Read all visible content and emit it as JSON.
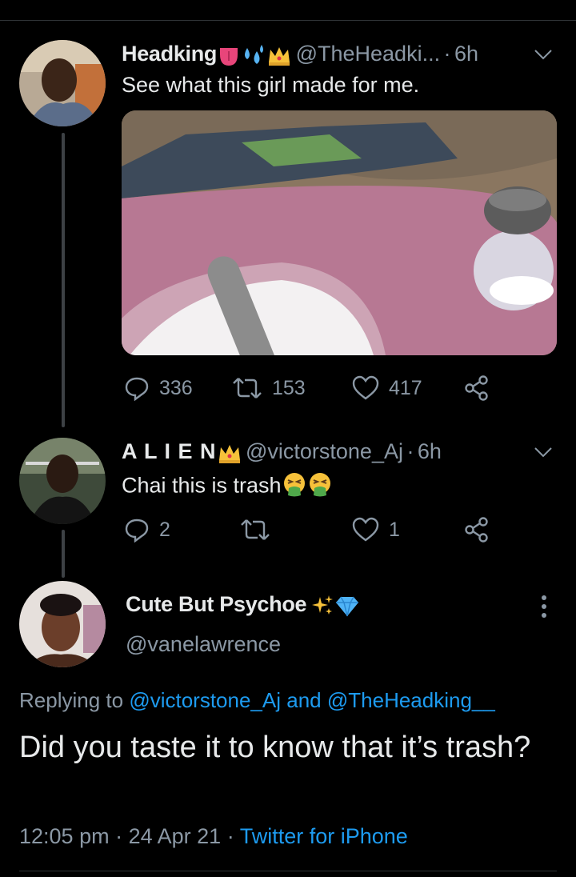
{
  "tweet1": {
    "name": "Headking",
    "handle": "@TheHeadki...",
    "separator": "·",
    "time": "6h",
    "text": "See what this girl made for me.",
    "replies": "336",
    "retweets": "153",
    "likes": "417",
    "badges": [
      "tongue-emoji",
      "sweat-droplets-emoji",
      "crown-emoji"
    ]
  },
  "tweet2": {
    "name": "A L I E N",
    "handle": "@victorstone_Aj",
    "separator": "·",
    "time": "6h",
    "text": "Chai this is trash",
    "replies": "2",
    "likes": "1",
    "badges": [
      "crown-emoji"
    ],
    "trailing_emojis": [
      "vomiting-face-emoji",
      "vomiting-face-emoji"
    ]
  },
  "main": {
    "name": "Cute But Psychoe",
    "handle": "@vanelawrence",
    "badges": [
      "sparkles-emoji",
      "gem-emoji"
    ],
    "replying_prefix": "Replying to",
    "reply_user1": "@victorstone_Aj",
    "reply_and": "and",
    "reply_user2": "@TheHeadking__",
    "text": "Did you taste it to know that it’s trash?",
    "time": "12:05 pm",
    "sep1": "·",
    "date": "24 Apr 21",
    "sep2": "·",
    "source": "Twitter for iPhone"
  },
  "colors": {
    "background": "#000000",
    "text": "#e7e9ea",
    "muted": "#8b98a5",
    "link": "#1d9bf0",
    "divider": "#2f3336"
  }
}
